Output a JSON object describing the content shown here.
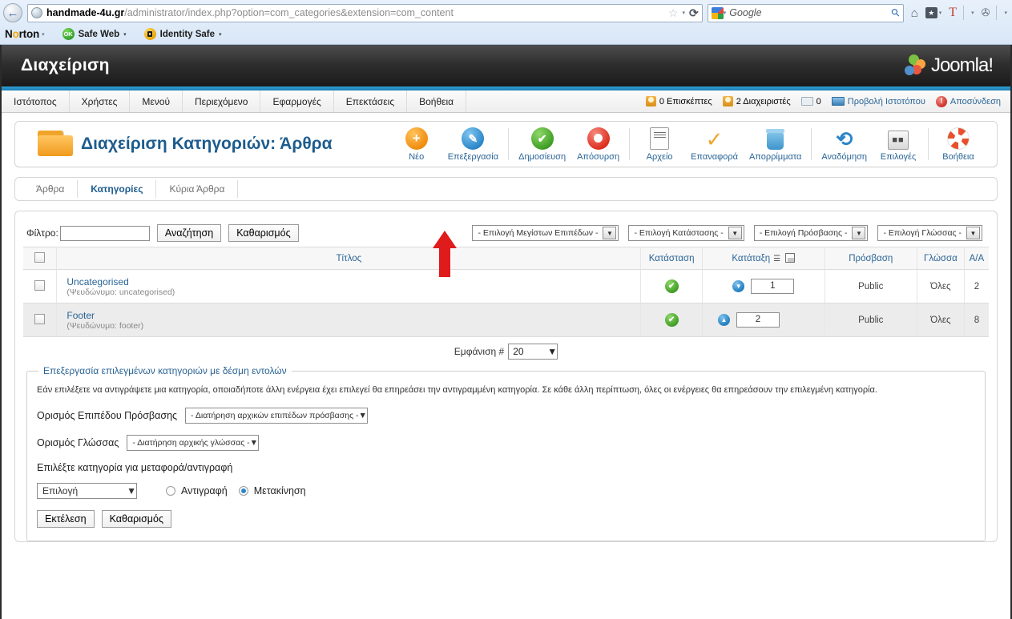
{
  "browser": {
    "back_label": "←",
    "url_host": "handmade-4u.gr",
    "url_path": "/administrator/index.php?option=com_categories&extension=com_content",
    "star": "☆",
    "reload": "⟳",
    "search_value": "Google",
    "search_icon": "⚲",
    "home_icon": "⌂",
    "box_icon": "★",
    "t_icon": "T",
    "bug_icon": "✇",
    "caret": "▾",
    "norton_logo_pre": "N",
    "norton_logo_o": "o",
    "norton_logo_post": "rton",
    "norton_items": [
      {
        "label": "Safe Web",
        "badge": "OK"
      },
      {
        "label": "Identity Safe",
        "badge": "lock"
      }
    ]
  },
  "admin": {
    "title": "Διαχείριση",
    "brand": "Joomla!",
    "menu": [
      "Ιστότοπος",
      "Χρήστες",
      "Μενού",
      "Περιεχόμενο",
      "Εφαρμογές",
      "Επεκτάσεις",
      "Βοήθεια"
    ],
    "status": {
      "visitors": "0 Επισκέπτες",
      "admins": "2 Διαχειριστές",
      "messages": "0",
      "preview": "Προβολή Ιστοτόπου",
      "logout": "Αποσύνδεση"
    }
  },
  "page": {
    "title": "Διαχείριση Κατηγοριών: Άρθρα",
    "toolbar": [
      {
        "label": "Νέο",
        "icon": "plus-icon"
      },
      {
        "label": "Επεξεργασία",
        "icon": "pencil-icon"
      },
      {
        "label": "Δημοσίευση",
        "icon": "check-circle-icon"
      },
      {
        "label": "Απόσυρση",
        "icon": "unpublish-icon"
      },
      {
        "label": "Αρχείο",
        "icon": "archive-icon"
      },
      {
        "label": "Επαναφορά",
        "icon": "checkmark-icon"
      },
      {
        "label": "Απορρίμματα",
        "icon": "trash-icon"
      },
      {
        "label": "Αναδόμηση",
        "icon": "refresh-icon"
      },
      {
        "label": "Επιλογές",
        "icon": "options-icon"
      },
      {
        "label": "Βοήθεια",
        "icon": "lifering-icon"
      }
    ],
    "tabs": [
      {
        "label": "Άρθρα",
        "active": false
      },
      {
        "label": "Κατηγορίες",
        "active": true
      },
      {
        "label": "Κύρια Άρθρα",
        "active": false
      }
    ]
  },
  "filter": {
    "label": "Φίλτρο:",
    "value": "",
    "search_button": "Αναζήτηση",
    "clear_button": "Καθαρισμός",
    "selects": [
      "- Επιλογή Μεγίστων Επιπέδων -",
      "- Επιλογή Κατάστασης -",
      "- Επιλογή Πρόσβασης -",
      "- Επιλογή Γλώσσας -"
    ]
  },
  "table": {
    "headers": {
      "title": "Τίτλος",
      "status": "Κατάσταση",
      "order": "Κατάταξη",
      "access": "Πρόσβαση",
      "language": "Γλώσσα",
      "id": "Α/Α"
    },
    "rows": [
      {
        "title": "Uncategorised",
        "alias": "(Ψευδώνυμο: uncategorised)",
        "status_icon": "✔",
        "order_arrow": "▼",
        "order_value": "1",
        "access": "Public",
        "language": "Όλες",
        "id": "2"
      },
      {
        "title": "Footer",
        "alias": "(Ψευδώνυμο: footer)",
        "status_icon": "✔",
        "order_arrow": "▲",
        "order_value": "2",
        "access": "Public",
        "language": "Όλες",
        "id": "8"
      }
    ]
  },
  "limit": {
    "label": "Εμφάνιση #",
    "value": "20"
  },
  "batch": {
    "legend": "Επεξεργασία επιλεγμένων κατηγοριών με δέσμη εντολών",
    "description": "Εάν επιλέξετε να αντιγράψετε μια κατηγορία, οποιαδήποτε άλλη ενέργεια έχει επιλεγεί θα επηρεάσει την αντιγραμμένη κατηγορία. Σε κάθε άλλη περίπτωση, όλες οι ενέργειες θα επηρεάσουν την επιλεγμένη κατηγορία.",
    "access_label": "Ορισμός Επιπέδου Πρόσβασης",
    "access_value": "- Διατήρηση αρχικών επιπέδων πρόσβασης -",
    "language_label": "Ορισμός Γλώσσας",
    "language_value": "- Διατήρηση αρχικής γλώσσας -",
    "category_label": "Επιλέξτε κατηγορία για μεταφορά/αντιγραφή",
    "category_value": "Επιλογή",
    "copy_label": "Αντιγραφή",
    "move_label": "Μετακίνηση",
    "process_button": "Εκτέλεση",
    "clear_button": "Καθαρισμός"
  },
  "annotation": {
    "arrow_color": "#e01b1b"
  }
}
